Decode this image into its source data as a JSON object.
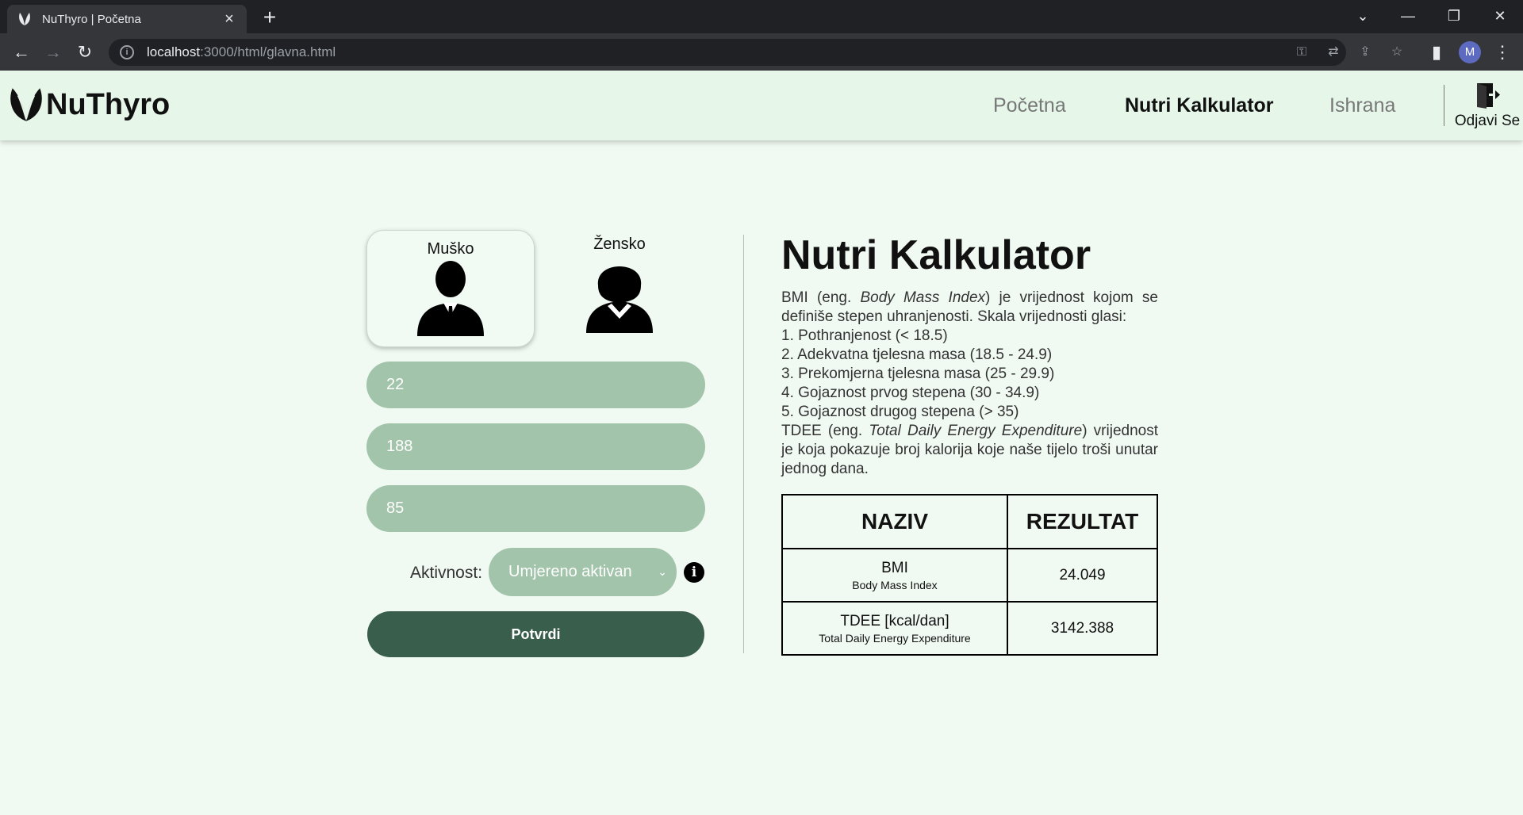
{
  "browser": {
    "tab_title": "NuThyro | Početna",
    "url_host": "localhost",
    "url_path": ":3000/html/glavna.html",
    "profile_initial": "M"
  },
  "header": {
    "logo_text": "NuThyro",
    "nav": [
      {
        "label": "Početna",
        "active": false
      },
      {
        "label": "Nutri Kalkulator",
        "active": true
      },
      {
        "label": "Ishrana",
        "active": false
      }
    ],
    "logout_label": "Odjavi Se"
  },
  "form": {
    "gender_male": "Muško",
    "gender_female": "Žensko",
    "selected_gender": "male",
    "age": "22",
    "height": "188",
    "weight": "85",
    "activity_label": "Aktivnost:",
    "activity_value": "Umjereno aktivan",
    "submit_label": "Potvrdi"
  },
  "calculator": {
    "title": "Nutri Kalkulator",
    "bmi_intro_pre": "BMI (eng. ",
    "bmi_intro_em": "Body Mass Index",
    "bmi_intro_post": ") je vrijednost kojom se definiše stepen uhranjenosti. Skala vrijednosti glasi:",
    "scale": [
      "1. Pothranjenost (< 18.5)",
      "2. Adekvatna tjelesna masa (18.5 - 24.9)",
      "3. Prekomjerna tjelesna masa (25 - 29.9)",
      "4. Gojaznost prvog stepena (30 - 34.9)",
      "5. Gojaznost drugog stepena (> 35)"
    ],
    "tdee_pre": "TDEE (eng. ",
    "tdee_em": "Total Daily Energy Expenditure",
    "tdee_post": ") vrijednost je koja pokazuje broj kalorija koje naše tijelo troši unutar jednog dana."
  },
  "table": {
    "col_name": "NAZIV",
    "col_result": "REZULTAT",
    "rows": [
      {
        "name": "BMI",
        "sub": "Body Mass Index",
        "value": "24.049"
      },
      {
        "name": "TDEE [kcal/dan]",
        "sub": "Total Daily Energy Expenditure",
        "value": "3142.388"
      }
    ]
  },
  "colors": {
    "page_bg": "#f0f9f2",
    "header_bg": "#e6f7ea",
    "field_bg": "#a2c4aa",
    "button_bg": "#3a5e4c"
  }
}
